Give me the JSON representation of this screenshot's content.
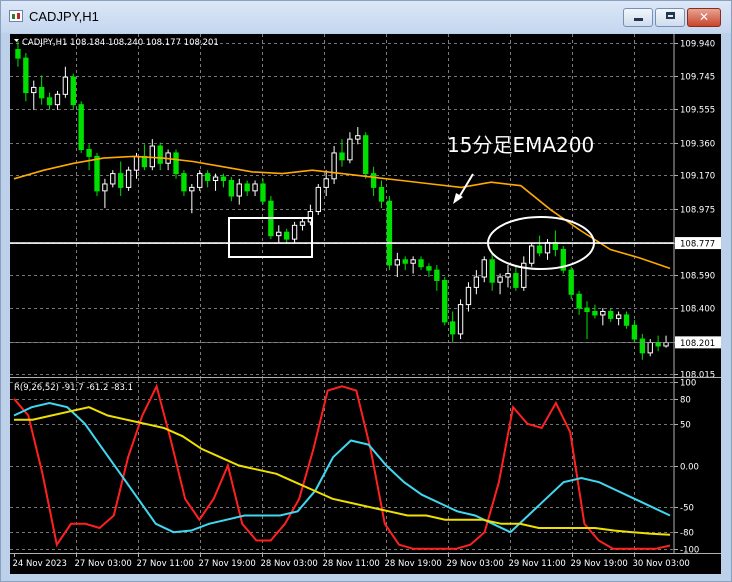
{
  "window": {
    "title": "CADJPY,H1",
    "close_glyph": "✕",
    "icons": [
      "chart-icon",
      "minimize-icon",
      "maximize-icon",
      "close-icon"
    ]
  },
  "colors": {
    "background": "#000000",
    "grid": "#9a9a9a",
    "bull": "#ffffff",
    "bear": "#00e000",
    "ema": "#ffaa00",
    "hline": "#ffffff",
    "rci_short": "#ff2020",
    "rci_mid": "#40d8f0",
    "rci_long": "#f0e000",
    "annotation": "#ffffff"
  },
  "chart_data": [
    {
      "type": "candlestick",
      "header": "CADJPY,H1  108.184 108.240 108.177 108.201",
      "y_ticks": [
        "109.940",
        "109.745",
        "109.555",
        "109.360",
        "109.170",
        "108.975",
        "108.777",
        "108.590",
        "108.400",
        "108.201",
        "108.015"
      ],
      "ylim": [
        108.0,
        109.99
      ],
      "x_ticks": [
        "24 Nov 2023",
        "27 Nov 03:00",
        "27 Nov 11:00",
        "27 Nov 19:00",
        "28 Nov 03:00",
        "28 Nov 11:00",
        "28 Nov 19:00",
        "29 Nov 03:00",
        "29 Nov 11:00",
        "29 Nov 19:00",
        "30 Nov 03:00"
      ],
      "horizontal_line": 108.777,
      "current_price": 108.201,
      "annotation": "15分足EMA200",
      "candles": [
        [
          109.9,
          109.95,
          109.8,
          109.85
        ],
        [
          109.85,
          109.88,
          109.6,
          109.65
        ],
        [
          109.65,
          109.72,
          109.55,
          109.68
        ],
        [
          109.68,
          109.75,
          109.58,
          109.62
        ],
        [
          109.62,
          109.65,
          109.55,
          109.58
        ],
        [
          109.58,
          109.66,
          109.55,
          109.64
        ],
        [
          109.64,
          109.8,
          109.62,
          109.74
        ],
        [
          109.74,
          109.76,
          109.55,
          109.58
        ],
        [
          109.58,
          109.6,
          109.3,
          109.32
        ],
        [
          109.32,
          109.35,
          109.2,
          109.28
        ],
        [
          109.28,
          109.3,
          109.05,
          109.08
        ],
        [
          109.08,
          109.15,
          108.98,
          109.12
        ],
        [
          109.12,
          109.2,
          109.1,
          109.18
        ],
        [
          109.18,
          109.25,
          109.05,
          109.1
        ],
        [
          109.1,
          109.22,
          109.08,
          109.2
        ],
        [
          109.2,
          109.3,
          109.15,
          109.28
        ],
        [
          109.28,
          109.35,
          109.2,
          109.22
        ],
        [
          109.22,
          109.38,
          109.2,
          109.34
        ],
        [
          109.34,
          109.36,
          109.2,
          109.24
        ],
        [
          109.24,
          109.32,
          109.2,
          109.3
        ],
        [
          109.3,
          109.32,
          109.15,
          109.18
        ],
        [
          109.18,
          109.2,
          109.05,
          109.08
        ],
        [
          109.08,
          109.12,
          108.95,
          109.1
        ],
        [
          109.1,
          109.2,
          109.08,
          109.18
        ],
        [
          109.18,
          109.2,
          109.1,
          109.14
        ],
        [
          109.14,
          109.18,
          109.08,
          109.16
        ],
        [
          109.16,
          109.18,
          109.1,
          109.14
        ],
        [
          109.14,
          109.16,
          109.02,
          109.05
        ],
        [
          109.05,
          109.15,
          109.0,
          109.12
        ],
        [
          109.12,
          109.14,
          109.05,
          109.08
        ],
        [
          109.08,
          109.14,
          109.05,
          109.12
        ],
        [
          109.12,
          109.15,
          109.0,
          109.02
        ],
        [
          109.02,
          109.05,
          108.8,
          108.82
        ],
        [
          108.82,
          108.88,
          108.78,
          108.84
        ],
        [
          108.84,
          108.86,
          108.78,
          108.8
        ],
        [
          108.8,
          108.9,
          108.78,
          108.88
        ],
        [
          108.88,
          108.92,
          108.85,
          108.9
        ],
        [
          108.9,
          109.0,
          108.88,
          108.96
        ],
        [
          108.96,
          109.12,
          108.94,
          109.1
        ],
        [
          109.1,
          109.2,
          109.05,
          109.15
        ],
        [
          109.15,
          109.34,
          109.12,
          109.3
        ],
        [
          109.3,
          109.38,
          109.22,
          109.26
        ],
        [
          109.26,
          109.42,
          109.24,
          109.38
        ],
        [
          109.38,
          109.45,
          109.35,
          109.4
        ],
        [
          109.4,
          109.42,
          109.15,
          109.18
        ],
        [
          109.18,
          109.22,
          109.05,
          109.1
        ],
        [
          109.1,
          109.14,
          108.98,
          109.02
        ],
        [
          109.02,
          109.05,
          108.62,
          108.65
        ],
        [
          108.65,
          108.72,
          108.58,
          108.68
        ],
        [
          108.68,
          108.7,
          108.62,
          108.66
        ],
        [
          108.66,
          108.7,
          108.6,
          108.68
        ],
        [
          108.68,
          108.7,
          108.62,
          108.64
        ],
        [
          108.64,
          108.66,
          108.58,
          108.62
        ],
        [
          108.62,
          108.65,
          108.5,
          108.56
        ],
        [
          108.56,
          108.58,
          108.3,
          108.32
        ],
        [
          108.32,
          108.38,
          108.2,
          108.25
        ],
        [
          108.25,
          108.45,
          108.22,
          108.42
        ],
        [
          108.42,
          108.55,
          108.38,
          108.52
        ],
        [
          108.52,
          108.62,
          108.48,
          108.58
        ],
        [
          108.58,
          108.7,
          108.55,
          108.68
        ],
        [
          108.68,
          108.72,
          108.5,
          108.55
        ],
        [
          108.55,
          108.6,
          108.48,
          108.58
        ],
        [
          108.58,
          108.65,
          108.52,
          108.6
        ],
        [
          108.6,
          108.65,
          108.5,
          108.52
        ],
        [
          108.52,
          108.7,
          108.5,
          108.66
        ],
        [
          108.66,
          108.78,
          108.64,
          108.76
        ],
        [
          108.76,
          108.82,
          108.7,
          108.72
        ],
        [
          108.72,
          108.8,
          108.68,
          108.78
        ],
        [
          108.78,
          108.85,
          108.7,
          108.74
        ],
        [
          108.74,
          108.76,
          108.6,
          108.62
        ],
        [
          108.62,
          108.64,
          108.45,
          108.48
        ],
        [
          108.48,
          108.5,
          108.36,
          108.4
        ],
        [
          108.4,
          108.44,
          108.22,
          108.38
        ],
        [
          108.38,
          108.42,
          108.34,
          108.36
        ],
        [
          108.36,
          108.4,
          108.3,
          108.38
        ],
        [
          108.38,
          108.4,
          108.32,
          108.34
        ],
        [
          108.34,
          108.38,
          108.3,
          108.36
        ],
        [
          108.36,
          108.38,
          108.28,
          108.3
        ],
        [
          108.3,
          108.33,
          108.2,
          108.22
        ],
        [
          108.22,
          108.25,
          108.1,
          108.14
        ],
        [
          108.14,
          108.22,
          108.12,
          108.2
        ],
        [
          108.2,
          108.24,
          108.15,
          108.18
        ],
        [
          108.18,
          108.24,
          108.17,
          108.2
        ]
      ],
      "ema": [
        109.15,
        109.2,
        109.24,
        109.27,
        109.28,
        109.27,
        109.25,
        109.22,
        109.19,
        109.18,
        109.2,
        109.18,
        109.16,
        109.14,
        109.12,
        109.1,
        109.13,
        109.11,
        108.97,
        108.85,
        108.74,
        108.69,
        108.63
      ]
    },
    {
      "type": "line",
      "header": "R(9,26,52) -91.7 -61.2 -83.1",
      "y_ticks": [
        "100",
        "80",
        "50",
        "0.00",
        "-50",
        "-80",
        "-100"
      ],
      "ylim": [
        -105,
        105
      ],
      "series": [
        {
          "values": [
            80,
            60,
            -10,
            -95,
            -70,
            -70,
            -75,
            -60,
            10,
            60,
            95,
            30,
            -40,
            -65,
            -40,
            0,
            -70,
            -90,
            -90,
            -70,
            -40,
            20,
            90,
            95,
            90,
            20,
            -70,
            -95,
            -100,
            -100,
            -100,
            -100,
            -95,
            -80,
            -20,
            70,
            50,
            45,
            75,
            40,
            -70,
            -90,
            -100,
            -100,
            -100,
            -100,
            -96
          ]
        },
        {
          "values": [
            60,
            70,
            75,
            70,
            50,
            20,
            -10,
            -40,
            -70,
            -80,
            -78,
            -70,
            -65,
            -60,
            -60,
            -60,
            -55,
            -30,
            10,
            30,
            25,
            0,
            -20,
            -35,
            -45,
            -55,
            -60,
            -70,
            -80,
            -60,
            -40,
            -20,
            -15,
            -20,
            -30,
            -40,
            -50,
            -60
          ]
        },
        {
          "values": [
            55,
            55,
            60,
            65,
            70,
            60,
            55,
            50,
            45,
            35,
            20,
            10,
            0,
            -5,
            -10,
            -20,
            -30,
            -40,
            -45,
            -50,
            -55,
            -60,
            -60,
            -65,
            -65,
            -65,
            -70,
            -70,
            -75,
            -75,
            -75,
            -75,
            -78,
            -80,
            -82,
            -83
          ]
        }
      ]
    }
  ]
}
